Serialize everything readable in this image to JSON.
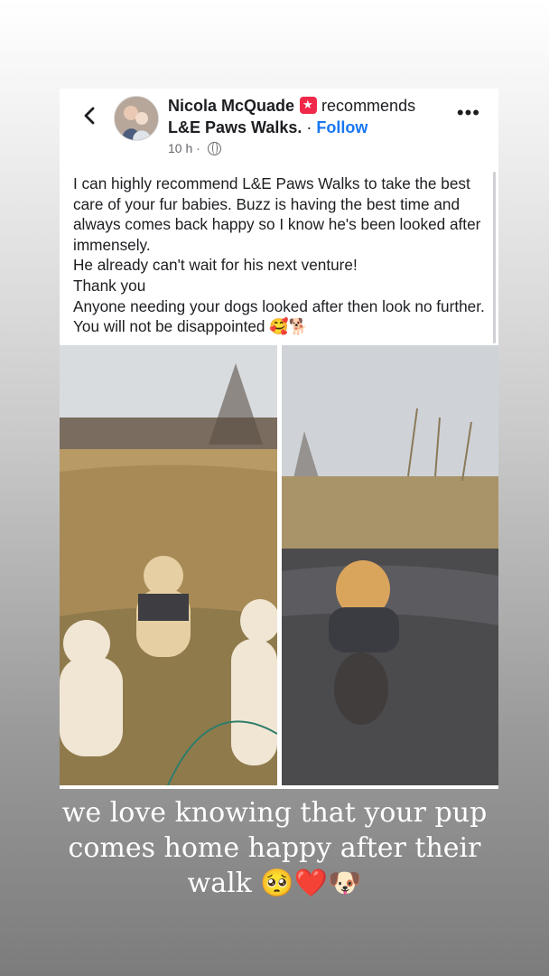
{
  "post": {
    "author": "Nicola McQuade",
    "recommends_label": "recommends",
    "page_name": "L&E Paws Walks.",
    "separator": "·",
    "follow_label": "Follow",
    "time": "10 h",
    "time_separator": "·",
    "more_label": "•••",
    "body_lines": [
      "I can highly recommend L&E Paws Walks to take the best care of your fur babies. Buzz is having the best time and always comes back happy so I know he's been looked after immensely.",
      "He already can't wait for his next venture!",
      "Thank you",
      "Anyone needing your dogs looked after then look no further. You will not be disappointed 🥰🐕"
    ]
  },
  "icons": {
    "back": "chevron-left-icon",
    "privacy": "globe-icon",
    "menu": "more-horizontal-icon",
    "badge": "recommendation-badge-icon"
  },
  "colors": {
    "link": "#1877f2",
    "badge": "#f02849",
    "text": "#1c1e21",
    "meta": "#65676b"
  },
  "story_caption": {
    "lines": [
      "we love knowing that your pup",
      "comes home happy after their",
      "walk 🥺❤️🐶"
    ]
  }
}
